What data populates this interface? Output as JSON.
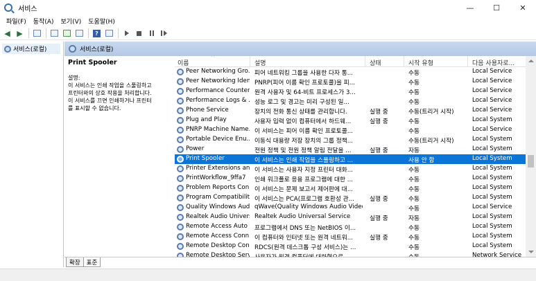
{
  "window": {
    "title": "서비스",
    "min": "—",
    "max": "☐",
    "close": "✕"
  },
  "menu": [
    "파일(F)",
    "동작(A)",
    "보기(V)",
    "도움말(H)"
  ],
  "tree": {
    "root_label": "서비스(로컬)"
  },
  "pane": {
    "header": "서비스(로컬)"
  },
  "details": {
    "service_name": "Print Spooler",
    "desc_label": "설명:",
    "desc_text": [
      "이 서비스는 인쇄 작업을 스풀링하고",
      "프린터와의 상호 작용을 처리합니다.",
      "이 서비스를 끄면 인쇄하거나 프린터",
      "를 표시할 수 없습니다."
    ]
  },
  "columns": {
    "name": "이름",
    "description": "설명",
    "status": "상태",
    "startup": "시작 유형",
    "logon": "다음 사용자로..."
  },
  "rows": [
    {
      "name": "Peer Networking Gro...",
      "desc": "피어 네트워킹 그룹을 사용한 다자 통...",
      "status": "",
      "startup": "수동",
      "logon": "Local Service"
    },
    {
      "name": "Peer Networking Iden...",
      "desc": "PNRP(피어 이름 확인 프로토콜)을 피...",
      "status": "",
      "startup": "수동",
      "logon": "Local Service"
    },
    {
      "name": "Performance Counter...",
      "desc": "원격 사용자 및 64-비트 프로세스가 3...",
      "status": "",
      "startup": "수동",
      "logon": "Local Service"
    },
    {
      "name": "Performance Logs & ...",
      "desc": "성능 로그 및 경고는 미리 구성된 일...",
      "status": "",
      "startup": "수동",
      "logon": "Local Service"
    },
    {
      "name": "Phone Service",
      "desc": "장치의 전화 통신 상태를 관리합니다.",
      "status": "실행 중",
      "startup": "수동(트리거 시작)",
      "logon": "Local Service"
    },
    {
      "name": "Plug and Play",
      "desc": "사용자 입력 없이 컴퓨터에서 하드웨...",
      "status": "실행 중",
      "startup": "수동",
      "logon": "Local System"
    },
    {
      "name": "PNRP Machine Name...",
      "desc": "이 서비스는 피어 이름 확인 프로토콜...",
      "status": "",
      "startup": "수동",
      "logon": "Local Service"
    },
    {
      "name": "Portable Device Enu...",
      "desc": "이동식 대용량 저장 장치의 그룹 정책...",
      "status": "",
      "startup": "수동(트리거 시작)",
      "logon": "Local System"
    },
    {
      "name": "Power",
      "desc": "전원 정책 및 전원 정책 알림 전달을 ...",
      "status": "실행 중",
      "startup": "자동",
      "logon": "Local System"
    },
    {
      "name": "Print Spooler",
      "desc": "이 서비스는 인쇄 작업을 스풀링하고 ...",
      "status": "",
      "startup": "사용 안 함",
      "logon": "Local System"
    },
    {
      "name": "Printer Extensions an...",
      "desc": "이 서비스는 사용자 지정 프린터 대화...",
      "status": "",
      "startup": "수동",
      "logon": "Local System"
    },
    {
      "name": "PrintWorkflow_9ffa7",
      "desc": "인쇄 워크플로 응용 프로그램에 대한 ...",
      "status": "",
      "startup": "수동",
      "logon": "Local System"
    },
    {
      "name": "Problem Reports Con...",
      "desc": "이 서비스는 문제 보고서 제어판에 대...",
      "status": "",
      "startup": "수동",
      "logon": "Local System"
    },
    {
      "name": "Program Compatibilit...",
      "desc": "이 서비스는 PCA(프로그램 호환성 관...",
      "status": "실행 중",
      "startup": "수동",
      "logon": "Local System"
    },
    {
      "name": "Quality Windows Aud...",
      "desc": "qWave(Quality Windows Audio Video...",
      "status": "",
      "startup": "수동",
      "logon": "Local Service"
    },
    {
      "name": "Realtek Audio Univers...",
      "desc": "Realtek Audio Universal Service",
      "status": "실행 중",
      "startup": "자동",
      "logon": "Local System"
    },
    {
      "name": "Remote Access Auto ...",
      "desc": "프로그램에서 DNS 또는 NetBIOS 이...",
      "status": "",
      "startup": "수동",
      "logon": "Local System"
    },
    {
      "name": "Remote Access Conn...",
      "desc": "이 컴퓨터와 인터넷 또는 원격 네트워...",
      "status": "실행 중",
      "startup": "수동",
      "logon": "Local System"
    },
    {
      "name": "Remote Desktop Con...",
      "desc": "RDCS(원격 데스크톱 구성 서비스)는 ...",
      "status": "",
      "startup": "수동",
      "logon": "Local System"
    },
    {
      "name": "Remote Desktop Serv...",
      "desc": "사용자가 원격 컴퓨터에 대화형으로 ...",
      "status": "",
      "startup": "수동",
      "logon": "Network Service"
    }
  ],
  "selected_row": 9,
  "tabs": [
    "확장",
    "표준"
  ],
  "colors": {
    "selection": "#0a74d8",
    "pane_header": "#b3c8e6"
  }
}
